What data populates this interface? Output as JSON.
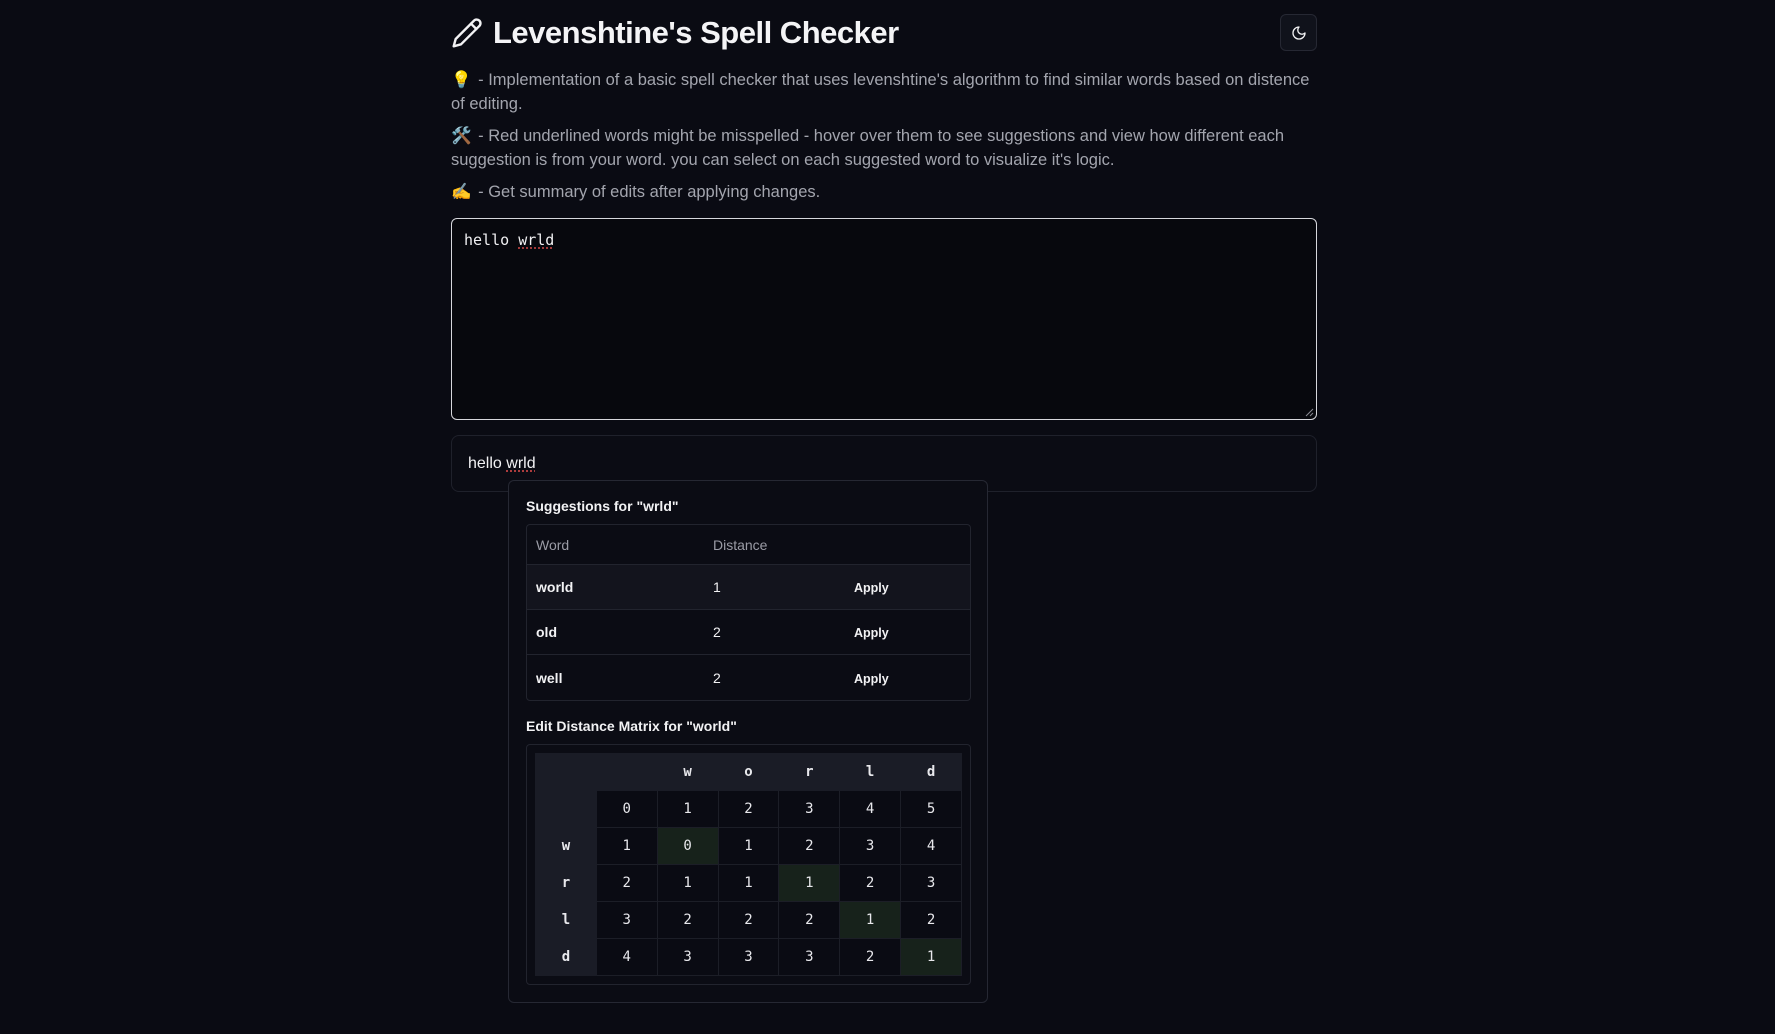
{
  "header": {
    "title": "Levenshtine's Spell Checker"
  },
  "descriptions": [
    {
      "emoji": "💡",
      "text": "- Implementation of a basic spell checker that uses levenshtine's algorithm to find similar words based on distence of editing."
    },
    {
      "emoji": "🛠️",
      "text": "- Red underlined words might be misspelled - hover over them to see suggestions and view how different each suggestion is from your word. you can select on each suggested word to visualize it's logic."
    },
    {
      "emoji": "✍️",
      "text": "- Get summary of edits after applying changes."
    }
  ],
  "editor": {
    "word1": "hello",
    "word2": "wrld"
  },
  "preview": {
    "word1": "hello",
    "word2": "wrld"
  },
  "popover": {
    "suggestions_heading": "Suggestions for \"wrld\"",
    "columns": [
      "Word",
      "Distance"
    ],
    "suggestions": [
      {
        "word": "world",
        "distance": "1",
        "action": "Apply"
      },
      {
        "word": "old",
        "distance": "2",
        "action": "Apply"
      },
      {
        "word": "well",
        "distance": "2",
        "action": "Apply"
      }
    ],
    "matrix_heading": "Edit Distance Matrix for \"world\"",
    "matrix": {
      "col_headers": [
        "",
        "",
        "w",
        "o",
        "r",
        "l",
        "d"
      ],
      "rows": [
        {
          "label": "",
          "cells": [
            "0",
            "1",
            "2",
            "3",
            "4",
            "5"
          ]
        },
        {
          "label": "w",
          "cells": [
            "1",
            "0",
            "1",
            "2",
            "3",
            "4"
          ]
        },
        {
          "label": "r",
          "cells": [
            "2",
            "1",
            "1",
            "1",
            "2",
            "3"
          ]
        },
        {
          "label": "l",
          "cells": [
            "3",
            "2",
            "2",
            "2",
            "1",
            "2"
          ]
        },
        {
          "label": "d",
          "cells": [
            "4",
            "3",
            "3",
            "3",
            "2",
            "1"
          ]
        }
      ],
      "highlighted_path": [
        [
          1,
          1
        ],
        [
          2,
          3
        ],
        [
          3,
          4
        ],
        [
          4,
          5
        ]
      ]
    }
  },
  "colors": {
    "background": "#0a0b13",
    "misspelled_underline": "#d44848",
    "path_highlight": "#17221b"
  },
  "icons": {
    "title": "pencil-icon",
    "theme_toggle": "moon-icon"
  }
}
